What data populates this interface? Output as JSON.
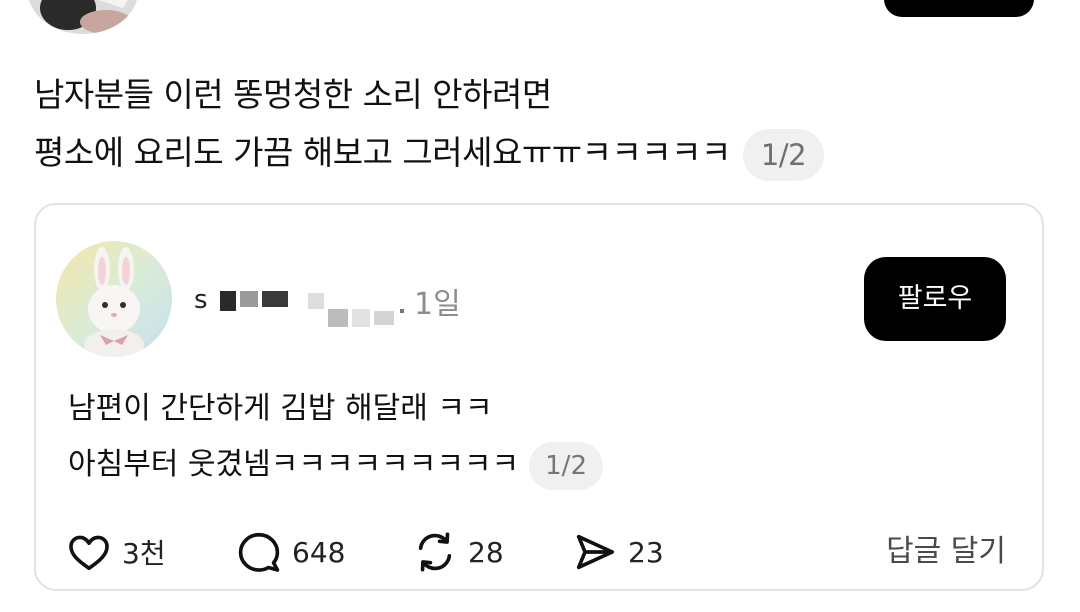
{
  "post": {
    "line1": "남자분들 이런 똥멍청한 소리 안하려면",
    "line2": "평소에 요리도 가끔 해보고 그러세요ㅠㅠㅋㅋㅋㅋㅋ",
    "page_indicator": "1/2"
  },
  "quoted": {
    "username_visible": "s",
    "time": "1일",
    "follow_label": "팔로우",
    "line1": "남편이 간단하게 김밥 해달래 ㅋㅋ",
    "line2": "아침부터 웃겼넴ㅋㅋㅋㅋㅋㅋㅋㅋㅋ",
    "page_indicator": "1/2",
    "actions": {
      "like_count": "3천",
      "comment_count": "648",
      "repost_count": "28",
      "share_count": "23",
      "reply_label": "답글 달기"
    }
  },
  "icons": {
    "like": "heart-icon",
    "comment": "speech-bubble-icon",
    "repost": "repost-icon",
    "share": "send-icon"
  }
}
